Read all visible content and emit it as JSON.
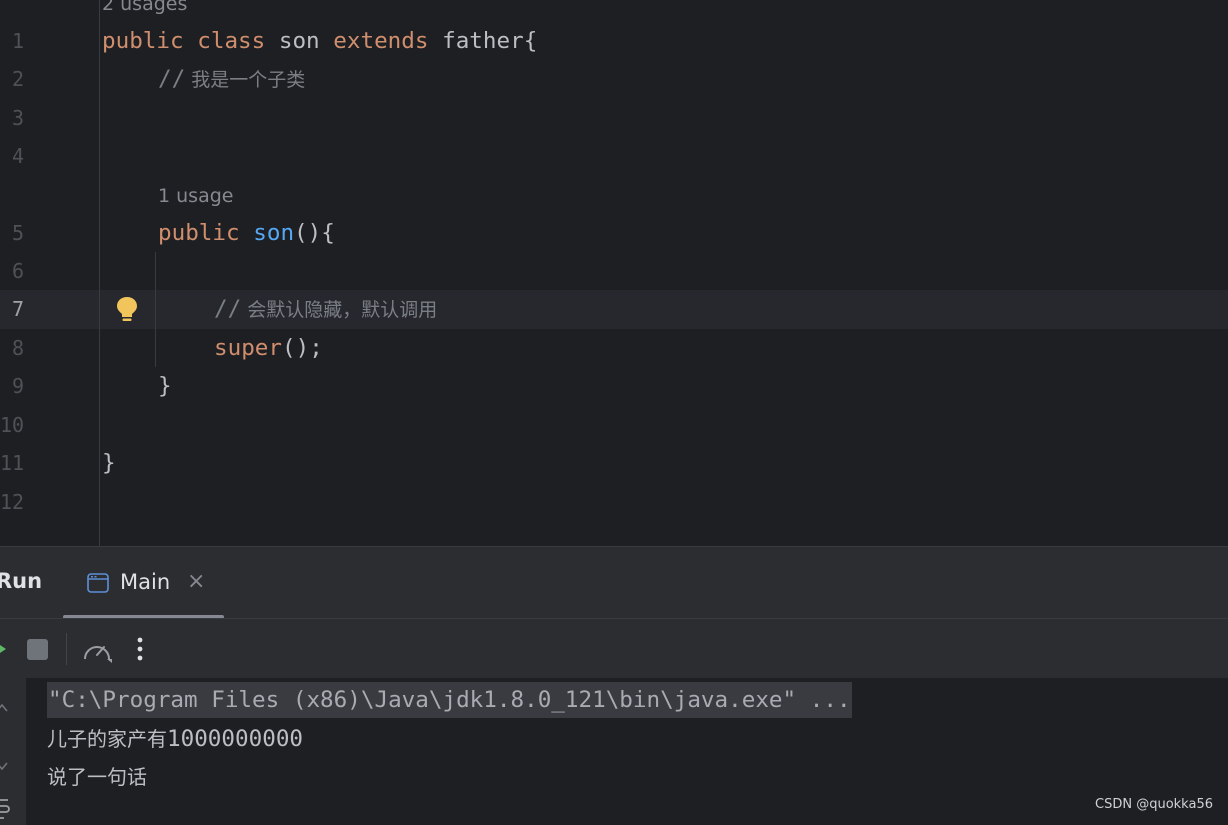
{
  "editor": {
    "usage_hints": {
      "class_usages": "2 usages",
      "ctor_usages": "1 usage"
    },
    "line_numbers": [
      "1",
      "2",
      "3",
      "4",
      "5",
      "6",
      "7",
      "8",
      "9",
      "10",
      "11",
      "12"
    ],
    "current_line": "7",
    "code": {
      "l1_kw1": "public",
      "l1_kw2": "class",
      "l1_name": " son ",
      "l1_kw3": "extends",
      "l1_rest": " father{",
      "l2_slash": "//",
      "l2_text": " 我是一个子类",
      "l5_kw": "public",
      "l5_fn": "son",
      "l5_rest": "(){",
      "l7_slash": "//",
      "l7_text": " 会默认隐藏，默认调用",
      "l8_kw": "super",
      "l8_rest": "();",
      "l9": "}",
      "l11": "}"
    }
  },
  "run_panel": {
    "title": "Run",
    "tab_label": "Main",
    "tab_close": "×",
    "console": {
      "command": "\"C:\\Program Files (x86)\\Java\\jdk1.8.0_121\\bin\\java.exe\" ...",
      "out1_text": "儿子的家产有",
      "out1_num": "1000000000",
      "out2": "说了一句话"
    }
  },
  "watermark": "CSDN @quokka56",
  "colors": {
    "keyword": "#cf8e6d",
    "function": "#56a8f5",
    "comment": "#7a7e85",
    "text": "#bcbec4",
    "bulb": "#f2c55c"
  }
}
